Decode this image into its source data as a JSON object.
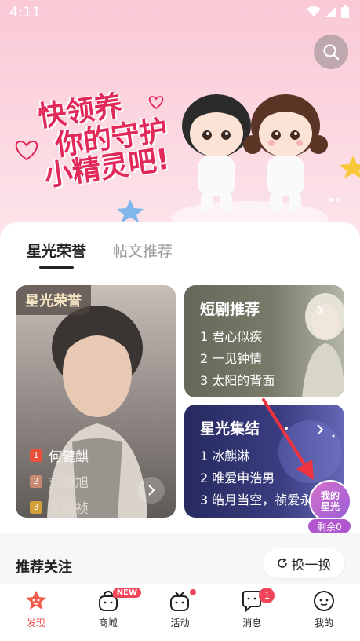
{
  "status_bar": {
    "time": "4:11"
  },
  "banner": {
    "slogan_lines": [
      "快领养",
      "你的守护",
      "小精灵吧!"
    ]
  },
  "tabs": [
    {
      "label": "星光荣誉",
      "active": true
    },
    {
      "label": "帖文推荐",
      "active": false
    }
  ],
  "hero_card": {
    "tag": "星光荣誉",
    "ranks": [
      {
        "num": "1",
        "name": "何健麒",
        "color": "#e8503c"
      },
      {
        "num": "2",
        "name": "刘萧旭",
        "color": "#c98a72"
      },
      {
        "num": "3",
        "name": "王皓祯",
        "color": "#d3a03a"
      }
    ]
  },
  "drama_card": {
    "title": "短剧推荐",
    "items": [
      "1  君心似疾",
      "2  一见钟情",
      "3  太阳的背面"
    ]
  },
  "star_card": {
    "title": "星光集结",
    "items": [
      "1  冰麒淋",
      "2  唯爱申浩男",
      "3  皓月当空，祯爱永"
    ]
  },
  "floating": {
    "line1": "我的",
    "line2": "星光",
    "remain": "剩余0"
  },
  "recommend": {
    "title": "推荐关注",
    "refresh": "换一换"
  },
  "bottom_nav": [
    {
      "label": "发现",
      "active": true
    },
    {
      "label": "商城",
      "badge": "NEW"
    },
    {
      "label": "活动",
      "dot": true
    },
    {
      "label": "消息",
      "count": "1"
    },
    {
      "label": "我的"
    }
  ],
  "colors": {
    "accent": "#e84a4a",
    "badge": "#f1465a",
    "slogan": "#e22a5a"
  }
}
